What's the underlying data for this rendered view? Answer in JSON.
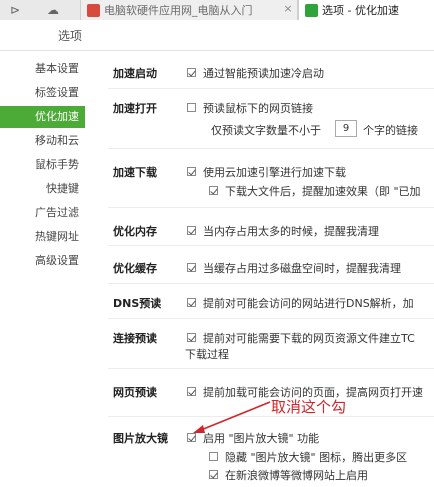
{
  "tabs": [
    {
      "label": "电脑软硬件应用网_电脑从入门",
      "active": false
    },
    {
      "label": "选项 - 优化加速",
      "active": true
    }
  ],
  "title": "选项",
  "sidebar": {
    "items": [
      {
        "label": "基本设置"
      },
      {
        "label": "标签设置"
      },
      {
        "label": "优化加速",
        "active": true
      },
      {
        "label": "移动和云"
      },
      {
        "label": "鼠标手势"
      },
      {
        "label": "快捷键"
      },
      {
        "label": "广告过滤"
      },
      {
        "label": "热键网址"
      },
      {
        "label": "高级设置"
      }
    ]
  },
  "settings": {
    "accel_start": {
      "label": "加速启动",
      "option": "通过智能预读加速冷启动"
    },
    "accel_open": {
      "label": "加速打开",
      "option": "预读鼠标下的网页链接",
      "sub_prefix": "仅预读文字数量不小于",
      "sub_value": "9",
      "sub_suffix": "个字的链接"
    },
    "accel_download": {
      "label": "加速下载",
      "option": "使用云加速引擎进行加速下载",
      "sub": "下载大文件后，提醒加速效果（即 \"已加"
    },
    "optimize_memory": {
      "label": "优化内存",
      "option": "当内存占用太多的时候，提醒我清理"
    },
    "optimize_cache": {
      "label": "优化缓存",
      "option": "当缓存占用过多磁盘空间时，提醒我清理"
    },
    "dns_prefetch": {
      "label": "DNS预读",
      "option": "提前对可能会访问的网站进行DNS解析，加"
    },
    "connection_prefetch": {
      "label": "连接预读",
      "option": "提前对可能需要下载的网页资源文件建立TC",
      "option_line2": "下载过程"
    },
    "page_prefetch": {
      "label": "网页预读",
      "option": "提前加载可能会访问的页面，提高网页打开速"
    },
    "image_zoom": {
      "label": "图片放大镜",
      "option": "启用 \"图片放大镜\" 功能",
      "sub1": "隐藏 \"图片放大镜\" 图标，腾出更多区",
      "sub2": "在新浪微博等微博网站上启用"
    }
  },
  "annotation": {
    "text": "取消这个勾",
    "color": "#d0262b"
  },
  "colors": {
    "accent": "#4caa37"
  }
}
